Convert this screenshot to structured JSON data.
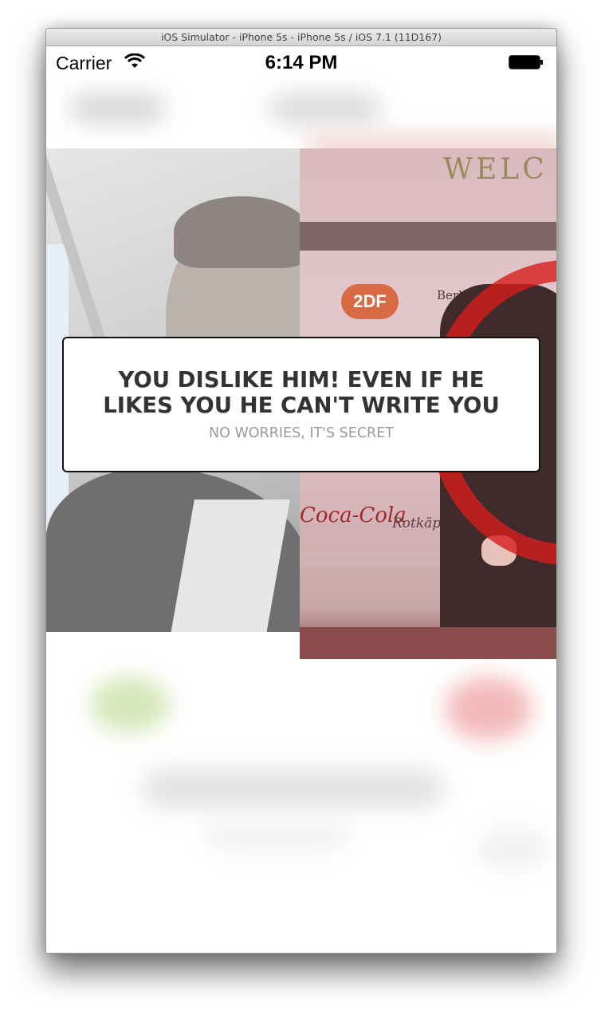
{
  "window": {
    "title": "iOS Simulator - iPhone 5s - iPhone 5s / iOS 7.1 (11D167)"
  },
  "status_bar": {
    "carrier": "Carrier",
    "time": "6:14 PM",
    "wifi_icon": "wifi-icon",
    "battery_icon": "battery-icon"
  },
  "photos": {
    "left": "blurred-man-photo",
    "right": "event-backdrop-photo",
    "backdrop_texts": {
      "welcome": "WELC",
      "zdf": "2DF",
      "berliner": "Berliner Kindl",
      "cocacola": "Coca-Cola",
      "rotkappchen": "Rotkäppchen"
    }
  },
  "alert": {
    "title": "YOU DISLIKE HIM! EVEN IF HE LIKES YOU HE CAN'T WRITE YOU",
    "subtitle": "NO WORRIES, IT'S SECRET"
  },
  "colors": {
    "accent_red": "#d71e1e",
    "text_dark": "#333333",
    "text_muted": "#9a9a9a"
  }
}
